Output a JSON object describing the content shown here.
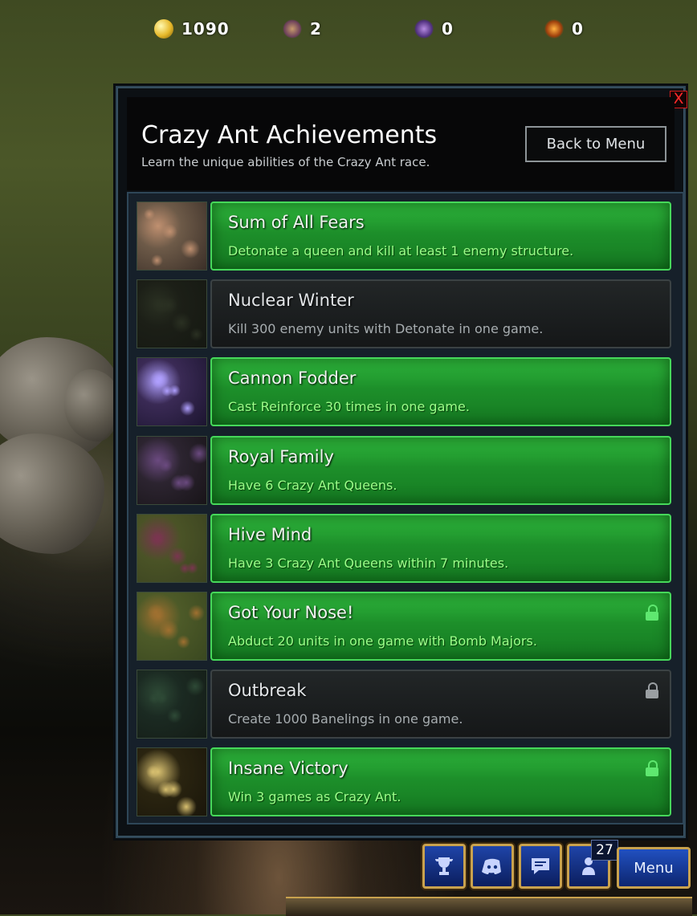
{
  "resources": [
    {
      "icon": "mineral-icon",
      "value": "1090"
    },
    {
      "icon": "crazy-ant-unit-icon",
      "value": "2"
    },
    {
      "icon": "purple-unit-icon",
      "value": "0"
    },
    {
      "icon": "explosion-icon",
      "value": "0"
    }
  ],
  "panel": {
    "title": "Crazy Ant Achievements",
    "subtitle": "Learn the unique abilities of the Crazy Ant race.",
    "back_label": "Back to Menu",
    "close_label": "X"
  },
  "achievements": [
    {
      "name": "Sum of All Fears",
      "desc": "Detonate a queen and kill at least 1 enemy structure.",
      "completed": true,
      "lock": false
    },
    {
      "name": "Nuclear Winter",
      "desc": "Kill 300 enemy units with Detonate in one game.",
      "completed": false,
      "lock": false
    },
    {
      "name": "Cannon Fodder",
      "desc": "Cast Reinforce 30 times in one game.",
      "completed": true,
      "lock": false
    },
    {
      "name": "Royal Family",
      "desc": "Have 6 Crazy Ant Queens.",
      "completed": true,
      "lock": false
    },
    {
      "name": "Hive Mind",
      "desc": "Have 3 Crazy Ant Queens within 7 minutes.",
      "completed": true,
      "lock": false
    },
    {
      "name": "Got Your Nose!",
      "desc": "Abduct 20 units in one game with Bomb Majors.",
      "completed": true,
      "lock": true
    },
    {
      "name": "Outbreak",
      "desc": "Create 1000 Banelings in one game.",
      "completed": false,
      "lock": true
    },
    {
      "name": "Insane Victory",
      "desc": "Win 3 games as Crazy Ant.",
      "completed": true,
      "lock": true
    }
  ],
  "bottom_bar": {
    "buttons": [
      "trophy-icon",
      "discord-icon",
      "chat-icon",
      "player-icon"
    ],
    "player_count": "27",
    "menu_label": "Menu"
  },
  "colors": {
    "completed": "#1d8f2a",
    "locked": "#1b1e1f",
    "accent_gold": "#c9a24e",
    "close_red": "#ff2a2a"
  }
}
